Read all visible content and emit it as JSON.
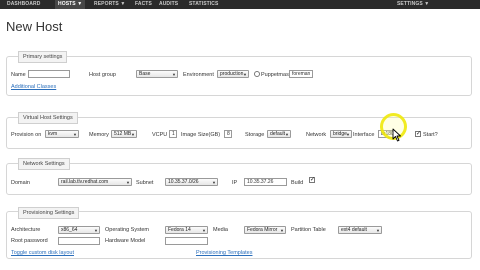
{
  "nav": {
    "items": [
      {
        "label": "DASHBOARD"
      },
      {
        "label": "HOSTS ▼"
      },
      {
        "label": "REPORTS ▼"
      },
      {
        "label": "FACTS"
      },
      {
        "label": "AUDITS"
      },
      {
        "label": "STATISTICS"
      }
    ],
    "settings_label": "SETTINGS ▼"
  },
  "page": {
    "title": "New Host"
  },
  "primary": {
    "legend": "Primary settings",
    "name_label": "Name",
    "name_value": "",
    "hostgroup_label": "Host group",
    "hostgroup_value": "Base",
    "environment_label": "Environment",
    "environment_value": "production",
    "puppetmaster_label": "Puppetmaster",
    "puppetmaster_value": "foreman",
    "additional_classes_link": "Additional Classes"
  },
  "virtual": {
    "legend": "Virtual Host Settings",
    "provision_on_label": "Provision on",
    "provision_on_value": "kvm",
    "memory_label": "Memory",
    "memory_value": "512 MB",
    "vcpu_label": "VCPU",
    "vcpu_value": "1",
    "image_size_label": "Image Size(GB)",
    "image_size_value": "8",
    "storage_label": "Storage",
    "storage_value": "default",
    "network_label": "Network",
    "network_value": "bridge",
    "interface_label": "Interface",
    "interface_value": "br180",
    "start_label": "Start?"
  },
  "network": {
    "legend": "Network Settings",
    "domain_label": "Domain",
    "domain_value": "rail.lab.tlv.redhat.com",
    "subnet_label": "Subnet",
    "subnet_value": "10.35.37.0/26",
    "ip_label": "IP",
    "ip_value": "10.35.37.26",
    "build_label": "Build"
  },
  "provisioning": {
    "legend": "Provisioning Settings",
    "architecture_label": "Architecture",
    "architecture_value": "x86_64",
    "os_label": "Operating System",
    "os_value": "Fedora 14",
    "media_label": "Media",
    "media_value": "Fedora Mirror",
    "partition_label": "Partition Table",
    "partition_value": "ext4 default",
    "root_password_label": "Root password",
    "hardware_model_label": "Hardware Model",
    "hardware_model_value": "",
    "toggle_disk_link": "Toggle custom disk layout",
    "provisioning_templates_link": "Provisioning Templates"
  }
}
